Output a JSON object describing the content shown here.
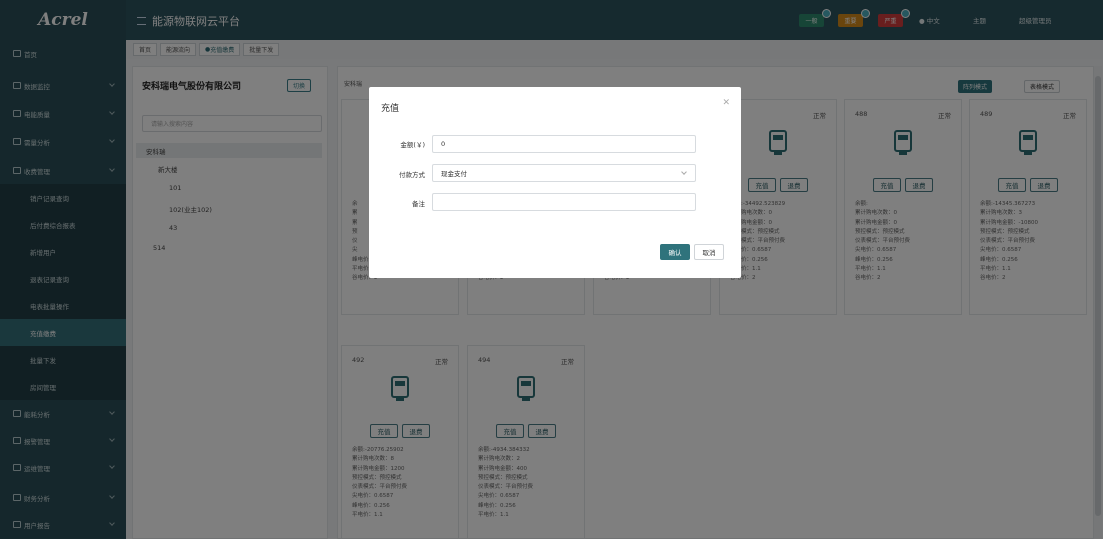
{
  "sidebar": {
    "logo": "Acrel",
    "items": [
      {
        "label": "首页",
        "icon": "home-icon",
        "type": "top"
      },
      {
        "label": "数据监控",
        "icon": "monitor-icon",
        "type": "top"
      },
      {
        "label": "电能质量",
        "icon": "power-quality-icon",
        "type": "top"
      },
      {
        "label": "需量分析",
        "icon": "demand-icon",
        "type": "top"
      },
      {
        "label": "收费管理",
        "icon": "billing-icon",
        "type": "top"
      },
      {
        "label": "销户记录查询",
        "type": "sub"
      },
      {
        "label": "后付费综合报表",
        "type": "sub"
      },
      {
        "label": "新增用户",
        "type": "sub"
      },
      {
        "label": "退表记录查询",
        "type": "sub"
      },
      {
        "label": "电表批量操作",
        "type": "sub"
      },
      {
        "label": "充值缴费",
        "type": "sub",
        "active": true
      },
      {
        "label": "批量下发",
        "type": "sub"
      },
      {
        "label": "房间管理",
        "type": "sub"
      },
      {
        "label": "能耗分析",
        "icon": "energy-icon",
        "type": "top"
      },
      {
        "label": "报警管理",
        "icon": "alarm-icon",
        "type": "top"
      },
      {
        "label": "运维管理",
        "icon": "maintenance-icon",
        "type": "top"
      },
      {
        "label": "财务分析",
        "icon": "finance-icon",
        "type": "top"
      },
      {
        "label": "用户报告",
        "icon": "report-icon",
        "type": "top"
      }
    ]
  },
  "header": {
    "title": "能源物联网云平台",
    "tags": [
      {
        "label": "一般",
        "color": "#2e8b6e",
        "count": "0"
      },
      {
        "label": "重要",
        "color": "#d58a1a",
        "count": "0"
      },
      {
        "label": "严重",
        "color": "#d23c3c",
        "count": "0"
      }
    ],
    "lang": "中文",
    "theme": "主题",
    "user": "超级管理员"
  },
  "breadcrumbs": [
    "首页",
    "能源流向",
    "充值缴费",
    "批量下发"
  ],
  "left_panel": {
    "company": "安科瑞电气股份有限公司",
    "switch_label": "切换",
    "search_placeholder": "请输入搜索内容",
    "tree": [
      "安科瑞",
      "新大楼",
      "101",
      "102(业主102)",
      "43",
      "514"
    ]
  },
  "right_panel": {
    "title": "安科瑞",
    "list_mode": "阵列模式",
    "table_mode": "表格模式"
  },
  "cards": [
    {
      "id": "",
      "status": "正常",
      "recharge": "充值",
      "refund": "退费",
      "lines": [
        "余",
        "累",
        "累",
        "预",
        "仪",
        "尖",
        "峰电价：0.256",
        "平电价：1.1",
        "谷电价：2"
      ]
    },
    {
      "id": "",
      "status": "",
      "recharge": "充值",
      "refund": "退费",
      "lines": [
        "",
        "",
        "",
        "",
        "",
        "",
        "峰电价：0.256",
        "平电价：1.1",
        "谷电价：2"
      ]
    },
    {
      "id": "",
      "status": "",
      "recharge": "充值",
      "refund": "退费",
      "lines": [
        "",
        "",
        "",
        "",
        "",
        "",
        "峰电价：0.256",
        "平电价：1.1",
        "谷电价：2"
      ]
    },
    {
      "id": "",
      "status": "正常",
      "recharge": "充值",
      "refund": "退费",
      "lines": [
        "余额:-34492.523829",
        "累计购电次数：0",
        "累计购电金额：0",
        "预控模式：预控模式",
        "仪表模式：平台预付费",
        "尖电价：0.6587",
        "峰电价：0.256",
        "平电价：1.1",
        "谷电价：2"
      ]
    },
    {
      "id": "488",
      "status": "正常",
      "recharge": "充值",
      "refund": "退费",
      "lines": [
        "余额:",
        "累计购电次数：0",
        "累计购电金额：0",
        "预控模式：预控模式",
        "仪表模式：平台预付费",
        "尖电价：0.6587",
        "峰电价：0.256",
        "平电价：1.1",
        "谷电价：2"
      ]
    },
    {
      "id": "489",
      "status": "正常",
      "recharge": "充值",
      "refund": "退费",
      "lines": [
        "余额:-14345.367273",
        "累计购电次数：3",
        "累计购电金额：-10800",
        "预控模式：预控模式",
        "仪表模式：平台预付费",
        "尖电价：0.6587",
        "峰电价：0.256",
        "平电价：1.1",
        "谷电价：2"
      ]
    },
    {
      "id": "492",
      "status": "正常",
      "recharge": "充值",
      "refund": "退费",
      "lines": [
        "余额:-20776.25902",
        "累计购电次数：8",
        "累计购电金额：1200",
        "预控模式：预控模式",
        "仪表模式：平台预付费",
        "尖电价：0.6587",
        "峰电价：0.256",
        "平电价：1.1"
      ]
    },
    {
      "id": "494",
      "status": "正常",
      "recharge": "充值",
      "refund": "退费",
      "lines": [
        "余额:-4934.384332",
        "累计购电次数：2",
        "累计购电金额：400",
        "预控模式：预控模式",
        "仪表模式：平台预付费",
        "尖电价：0.6587",
        "峰电价：0.256",
        "平电价：1.1"
      ]
    }
  ],
  "modal": {
    "title": "充值",
    "amount_label": "金额(￥)",
    "amount_value": "0",
    "pay_label": "付款方式",
    "pay_value": "现金支付",
    "note_label": "备注",
    "note_value": "",
    "ok": "确认",
    "cancel": "取消"
  }
}
